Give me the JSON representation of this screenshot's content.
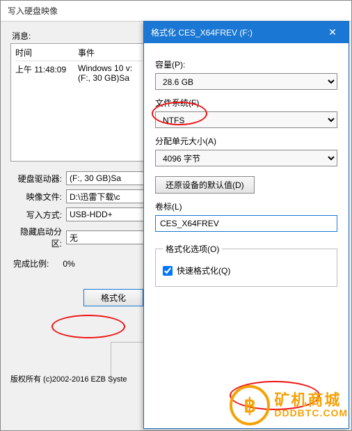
{
  "main": {
    "title": "写入硬盘映像",
    "msg_label": "消息:",
    "log": {
      "col_time": "时间",
      "col_event": "事件",
      "row1_time": "上午 11:48:09",
      "row1_event": "Windows 10 v:\n(F:, 30 GB)Sa"
    },
    "fields": {
      "drive_label": "硬盘驱动器:",
      "drive_value": "(F:, 30 GB)Sa",
      "image_label": "映像文件:",
      "image_value": "D:\\迅雷下载\\c",
      "write_label": "写入方式:",
      "write_value": "USB-HDD+",
      "hidden_label": "隐藏启动分区:",
      "hidden_value": "无",
      "pct_label": "完成比例:",
      "pct_value": "0%"
    },
    "format_btn": "格式化",
    "copyright": "版权所有 (c)2002-2016 EZB Syste"
  },
  "fmt": {
    "title": "格式化 CES_X64FREV (F:)",
    "close": "✕",
    "capacity_label": "容量(P):",
    "capacity_value": "28.6 GB",
    "fs_label": "文件系统(F)",
    "fs_value": "NTFS",
    "alloc_label": "分配单元大小(A)",
    "alloc_value": "4096 字节",
    "restore_btn": "还原设备的默认值(D)",
    "vol_label": "卷标(L)",
    "vol_value": "CES_X64FREV",
    "opts_legend": "格式化选项(O)",
    "quick_label": "快速格式化(Q)"
  },
  "watermark": {
    "symbol": "฿",
    "line1": "矿机商城",
    "line2": "DDDBTC.COM"
  }
}
